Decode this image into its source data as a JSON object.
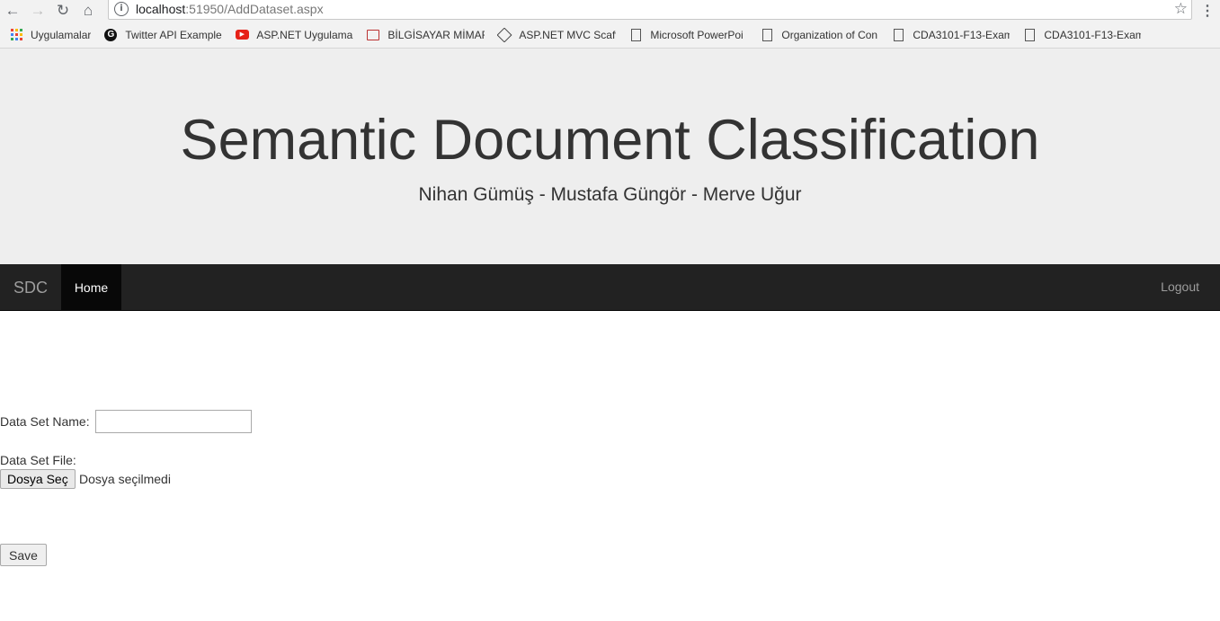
{
  "browser": {
    "url_host": "localhost",
    "url_path": ":51950/AddDataset.aspx",
    "bookmarks": [
      {
        "label": "Uygulamalar",
        "icon": "apps-grid-icon"
      },
      {
        "label": "Twitter API Example",
        "icon": "g-logo-icon"
      },
      {
        "label": "ASP.NET Uygulamal",
        "icon": "youtube-icon"
      },
      {
        "label": "BİLGİSAYAR MİMARİ",
        "icon": "presentation-icon"
      },
      {
        "label": "ASP.NET MVC Scaffo",
        "icon": "diamond-icon"
      },
      {
        "label": "Microsoft PowerPoi",
        "icon": "page-icon"
      },
      {
        "label": "Organization of Con",
        "icon": "page-icon"
      },
      {
        "label": "CDA3101-F13-Exam",
        "icon": "page-icon"
      },
      {
        "label": "CDA3101-F13-Exam",
        "icon": "page-icon"
      }
    ]
  },
  "header": {
    "title": "Semantic Document Classification",
    "authors": "Nihan Gümüş - Mustafa Güngör - Merve Uğur"
  },
  "navbar": {
    "brand": "SDC",
    "home": "Home",
    "logout": "Logout"
  },
  "form": {
    "name_label": "Data Set Name:",
    "name_value": "",
    "file_label": "Data Set File:",
    "file_button": "Dosya Seç",
    "file_status": "Dosya seçilmedi",
    "save_button": "Save"
  },
  "colors": {
    "jumbotron_bg": "#eeeeee",
    "navbar_bg": "#222222",
    "navbar_active_bg": "#080808"
  }
}
